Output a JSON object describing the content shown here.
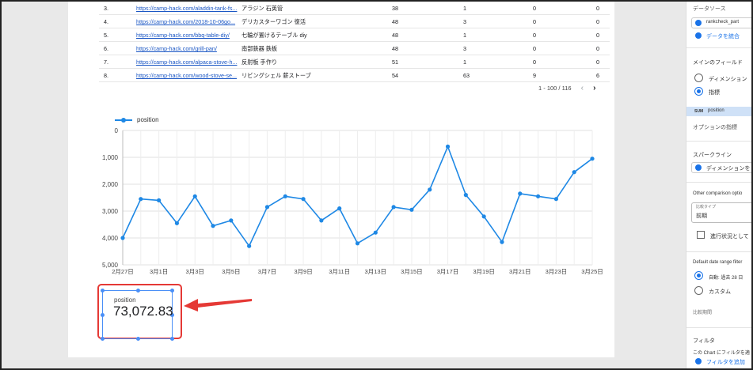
{
  "table": {
    "rows": [
      {
        "no": "3.",
        "url": "https://camp-hack.com/aladdin-tank-fs...",
        "query": "アラジン 石英管",
        "a": "38",
        "b": "1",
        "c": "0",
        "d": "0"
      },
      {
        "no": "4.",
        "url": "https://camp-hack.com/2018-10-06go...",
        "query": "デリカスターワゴン 復活",
        "a": "48",
        "b": "3",
        "c": "0",
        "d": "0"
      },
      {
        "no": "5.",
        "url": "https://camp-hack.com/bbq-table-diy/",
        "query": "七輪が置けるテーブル diy",
        "a": "48",
        "b": "1",
        "c": "0",
        "d": "0"
      },
      {
        "no": "6.",
        "url": "https://camp-hack.com/grill-pan/",
        "query": "南部鉄器 鉄板",
        "a": "48",
        "b": "3",
        "c": "0",
        "d": "0"
      },
      {
        "no": "7.",
        "url": "https://camp-hack.com/alpaca-stove-h...",
        "query": "反射板 手作り",
        "a": "51",
        "b": "1",
        "c": "0",
        "d": "0"
      },
      {
        "no": "8.",
        "url": "https://camp-hack.com/wood-stove-se...",
        "query": "リビングシェル 薪ストーブ",
        "a": "54",
        "b": "63",
        "c": "9",
        "d": "6"
      }
    ],
    "pager": "1 - 100 / 116",
    "prev": "‹",
    "next": "›"
  },
  "chart_data": {
    "type": "line",
    "legend": [
      "position"
    ],
    "x": [
      "2月27日",
      "2月28日",
      "3月1日",
      "3月2日",
      "3月3日",
      "3月4日",
      "3月5日",
      "3月6日",
      "3月7日",
      "3月8日",
      "3月9日",
      "3月10日",
      "3月11日",
      "3月12日",
      "3月13日",
      "3月14日",
      "3月15日",
      "3月16日",
      "3月17日",
      "3月18日",
      "3月19日",
      "3月20日",
      "3月21日",
      "3月22日",
      "3月23日",
      "3月24日",
      "3月25日"
    ],
    "x_tick_labels": [
      "2月27日",
      "3月1日",
      "3月3日",
      "3月5日",
      "3月7日",
      "3月9日",
      "3月11日",
      "3月13日",
      "3月15日",
      "3月17日",
      "3月19日",
      "3月21日",
      "3月23日",
      "3月25日"
    ],
    "series": [
      {
        "name": "position",
        "values": [
          4000,
          2550,
          2600,
          3450,
          2450,
          3550,
          3350,
          4300,
          2850,
          2450,
          2550,
          3350,
          2900,
          4200,
          3800,
          2850,
          2950,
          2200,
          600,
          2400,
          3200,
          4150,
          2350,
          2450,
          2550,
          1550,
          1050
        ]
      }
    ],
    "y_ticks": [
      "0",
      "1,000",
      "2,000",
      "3,000",
      "4,000",
      "5,000"
    ],
    "ylim": [
      0,
      5000
    ],
    "y_reversed": true,
    "grid": true,
    "color": "#1e88e5"
  },
  "scorecard": {
    "label": "position",
    "value": "73,072.83"
  },
  "panel": {
    "datasource_label": "データソース",
    "datasource_name": "rankcheck_part",
    "blend_label": "データを統合",
    "main_field_label": "メインのフィールド",
    "dimension_radio": "ディメンション",
    "metric_radio": "指標",
    "field_tag": "SUM",
    "field_name": "position",
    "optional_metric": "オプションの指標",
    "sparkline_label": "スパークライン",
    "sparkline_dim": "ディメンションを",
    "comparison_label": "Other comparison optio",
    "comparison_type_label": "比較タイプ",
    "comparison_type_value": "前期",
    "progress_label": "進行状況として",
    "date_range_label": "Default date range filter",
    "auto_radio": "自動: 過去 28 日",
    "custom_radio": "カスタム",
    "compare_period": "比較期間",
    "filter_label": "フィルタ",
    "filter_desc": "この Chart にフィルタを適",
    "add_filter": "フィルタを追加"
  }
}
